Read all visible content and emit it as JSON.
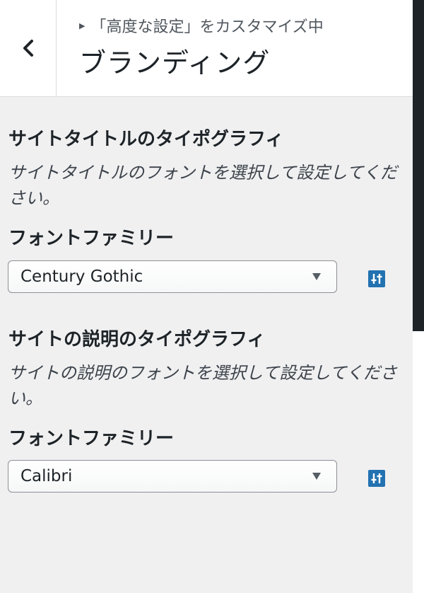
{
  "header": {
    "breadcrumb": "「高度な設定」をカスタマイズ中",
    "title": "ブランディング"
  },
  "groups": [
    {
      "heading": "サイトタイトルのタイポグラフィ",
      "description": "サイトタイトルのフォントを選択して設定してください。",
      "field_label": "フォントファミリー",
      "selected": "Century Gothic"
    },
    {
      "heading": "サイトの説明のタイポグラフィ",
      "description": "サイトの説明のフォントを選択して設定してください。",
      "field_label": "フォントファミリー",
      "selected": "Calibri"
    }
  ],
  "colors": {
    "accent": "#2271b1",
    "panel_bg": "#f0f0f1",
    "header_bg": "#ffffff"
  }
}
